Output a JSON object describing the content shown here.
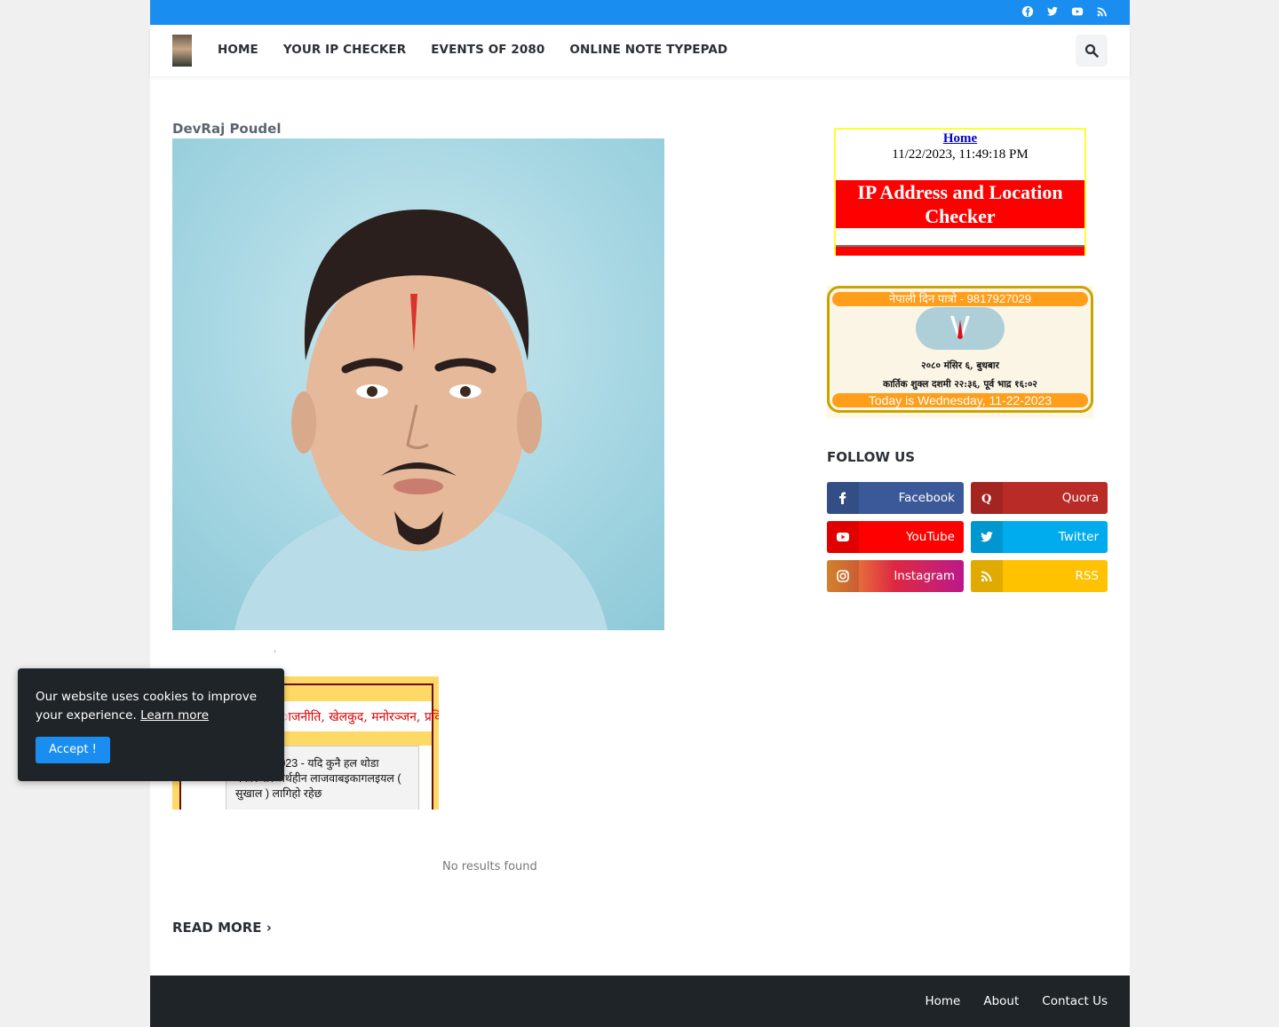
{
  "topbar": {
    "social_icons": [
      "facebook-icon",
      "twitter-icon",
      "youtube-icon",
      "rss-icon"
    ],
    "bg_color": "#1a8ef0"
  },
  "header": {
    "nav": [
      "HOME",
      "YOUR IP CHECKER",
      "EVENTS OF 2080",
      "ONLINE NOTE TYPEPAD"
    ]
  },
  "post": {
    "author": "DevRaj Poudel",
    "separator": ",",
    "embed_headline": "ाजनीति, खेलकुद, मनोरञ्जन, प्रविधि, व्यापार",
    "embed_news": "ber 28, 2023 - यदि कुनै हल थोडा बेकारुपरि अर्थहीन लाजवाबइकागलइयल ( सुखाल ) लागिहो रहेछ",
    "no_results": "No results found",
    "read_more": "READ MORE"
  },
  "sidebar": {
    "ip_widget": {
      "home_link": "Home",
      "datetime": "11/22/2023, 11:49:18 PM",
      "title": "IP Address and Location Checker"
    },
    "calendar": {
      "top_bar": "नेपाली दिन पात्रो - 9817927029",
      "nepali_date": "२०८० मंसिर ६, बुधबार",
      "tithi": "कार्तिक शुक्ल दशमी २२:३६, पूर्व भाद्र १६:०२",
      "today": "Today is Wednesday, 11-22-2023"
    },
    "follow_title": "FOLLOW US",
    "social": [
      {
        "label": "Facebook",
        "color": "#3b5998",
        "icon": "facebook-icon"
      },
      {
        "label": "Quora",
        "color": "#b92b27",
        "icon": "quora-icon"
      },
      {
        "label": "YouTube",
        "color": "#ff0000",
        "icon": "youtube-icon"
      },
      {
        "label": "Twitter",
        "color": "#00acee",
        "icon": "twitter-icon"
      },
      {
        "label": "Instagram",
        "color": "#d6249f",
        "icon": "instagram-icon"
      },
      {
        "label": "RSS",
        "color": "#ffc200",
        "icon": "rss-icon"
      }
    ]
  },
  "cookie": {
    "message": "Our website uses cookies to improve your experience.",
    "learn_more": "Learn more",
    "accept": "Accept !"
  },
  "footer": {
    "links": [
      "Home",
      "About",
      "Contact Us"
    ]
  }
}
